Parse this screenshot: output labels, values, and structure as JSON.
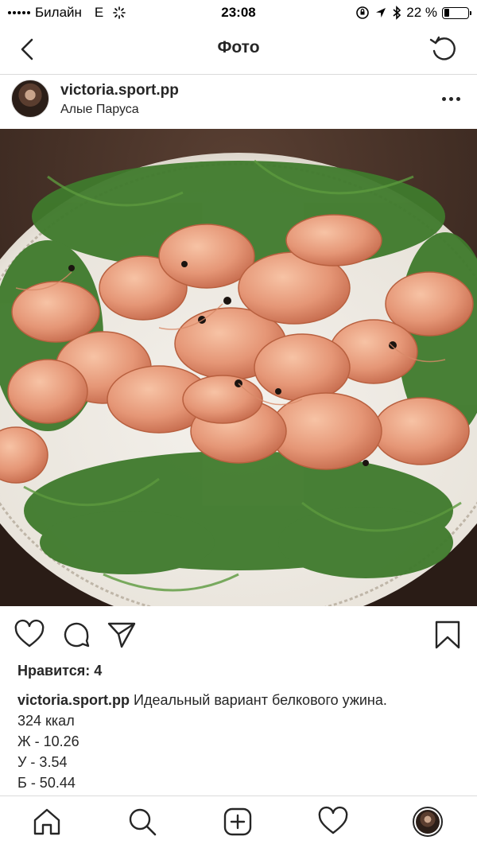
{
  "status_bar": {
    "carrier": "Билайн",
    "network": "E",
    "time": "23:08",
    "battery_percent": "22 %",
    "battery_level": 0.22
  },
  "nav": {
    "title": "Фото"
  },
  "post": {
    "username": "victoria.sport.pp",
    "location": "Алые Паруса",
    "likes_label": "Нравится: 4",
    "caption_username": "victoria.sport.pp",
    "caption_text": "Идеальный вариант белкового ужина.",
    "caption_lines": [
      "324 ккал",
      "Ж - 10.26",
      "У - 3.54",
      "Б - 50.44"
    ]
  },
  "icons": {
    "back": "chevron-left-icon",
    "refresh": "refresh-icon",
    "more": "more-icon",
    "like": "heart-icon",
    "comment": "comment-icon",
    "share": "send-icon",
    "save": "bookmark-icon",
    "tabs": [
      "home-icon",
      "search-icon",
      "add-icon",
      "heart-icon",
      "profile-avatar"
    ]
  },
  "colors": {
    "text": "#262626",
    "divider": "#dbdbdb",
    "background": "#ffffff"
  }
}
